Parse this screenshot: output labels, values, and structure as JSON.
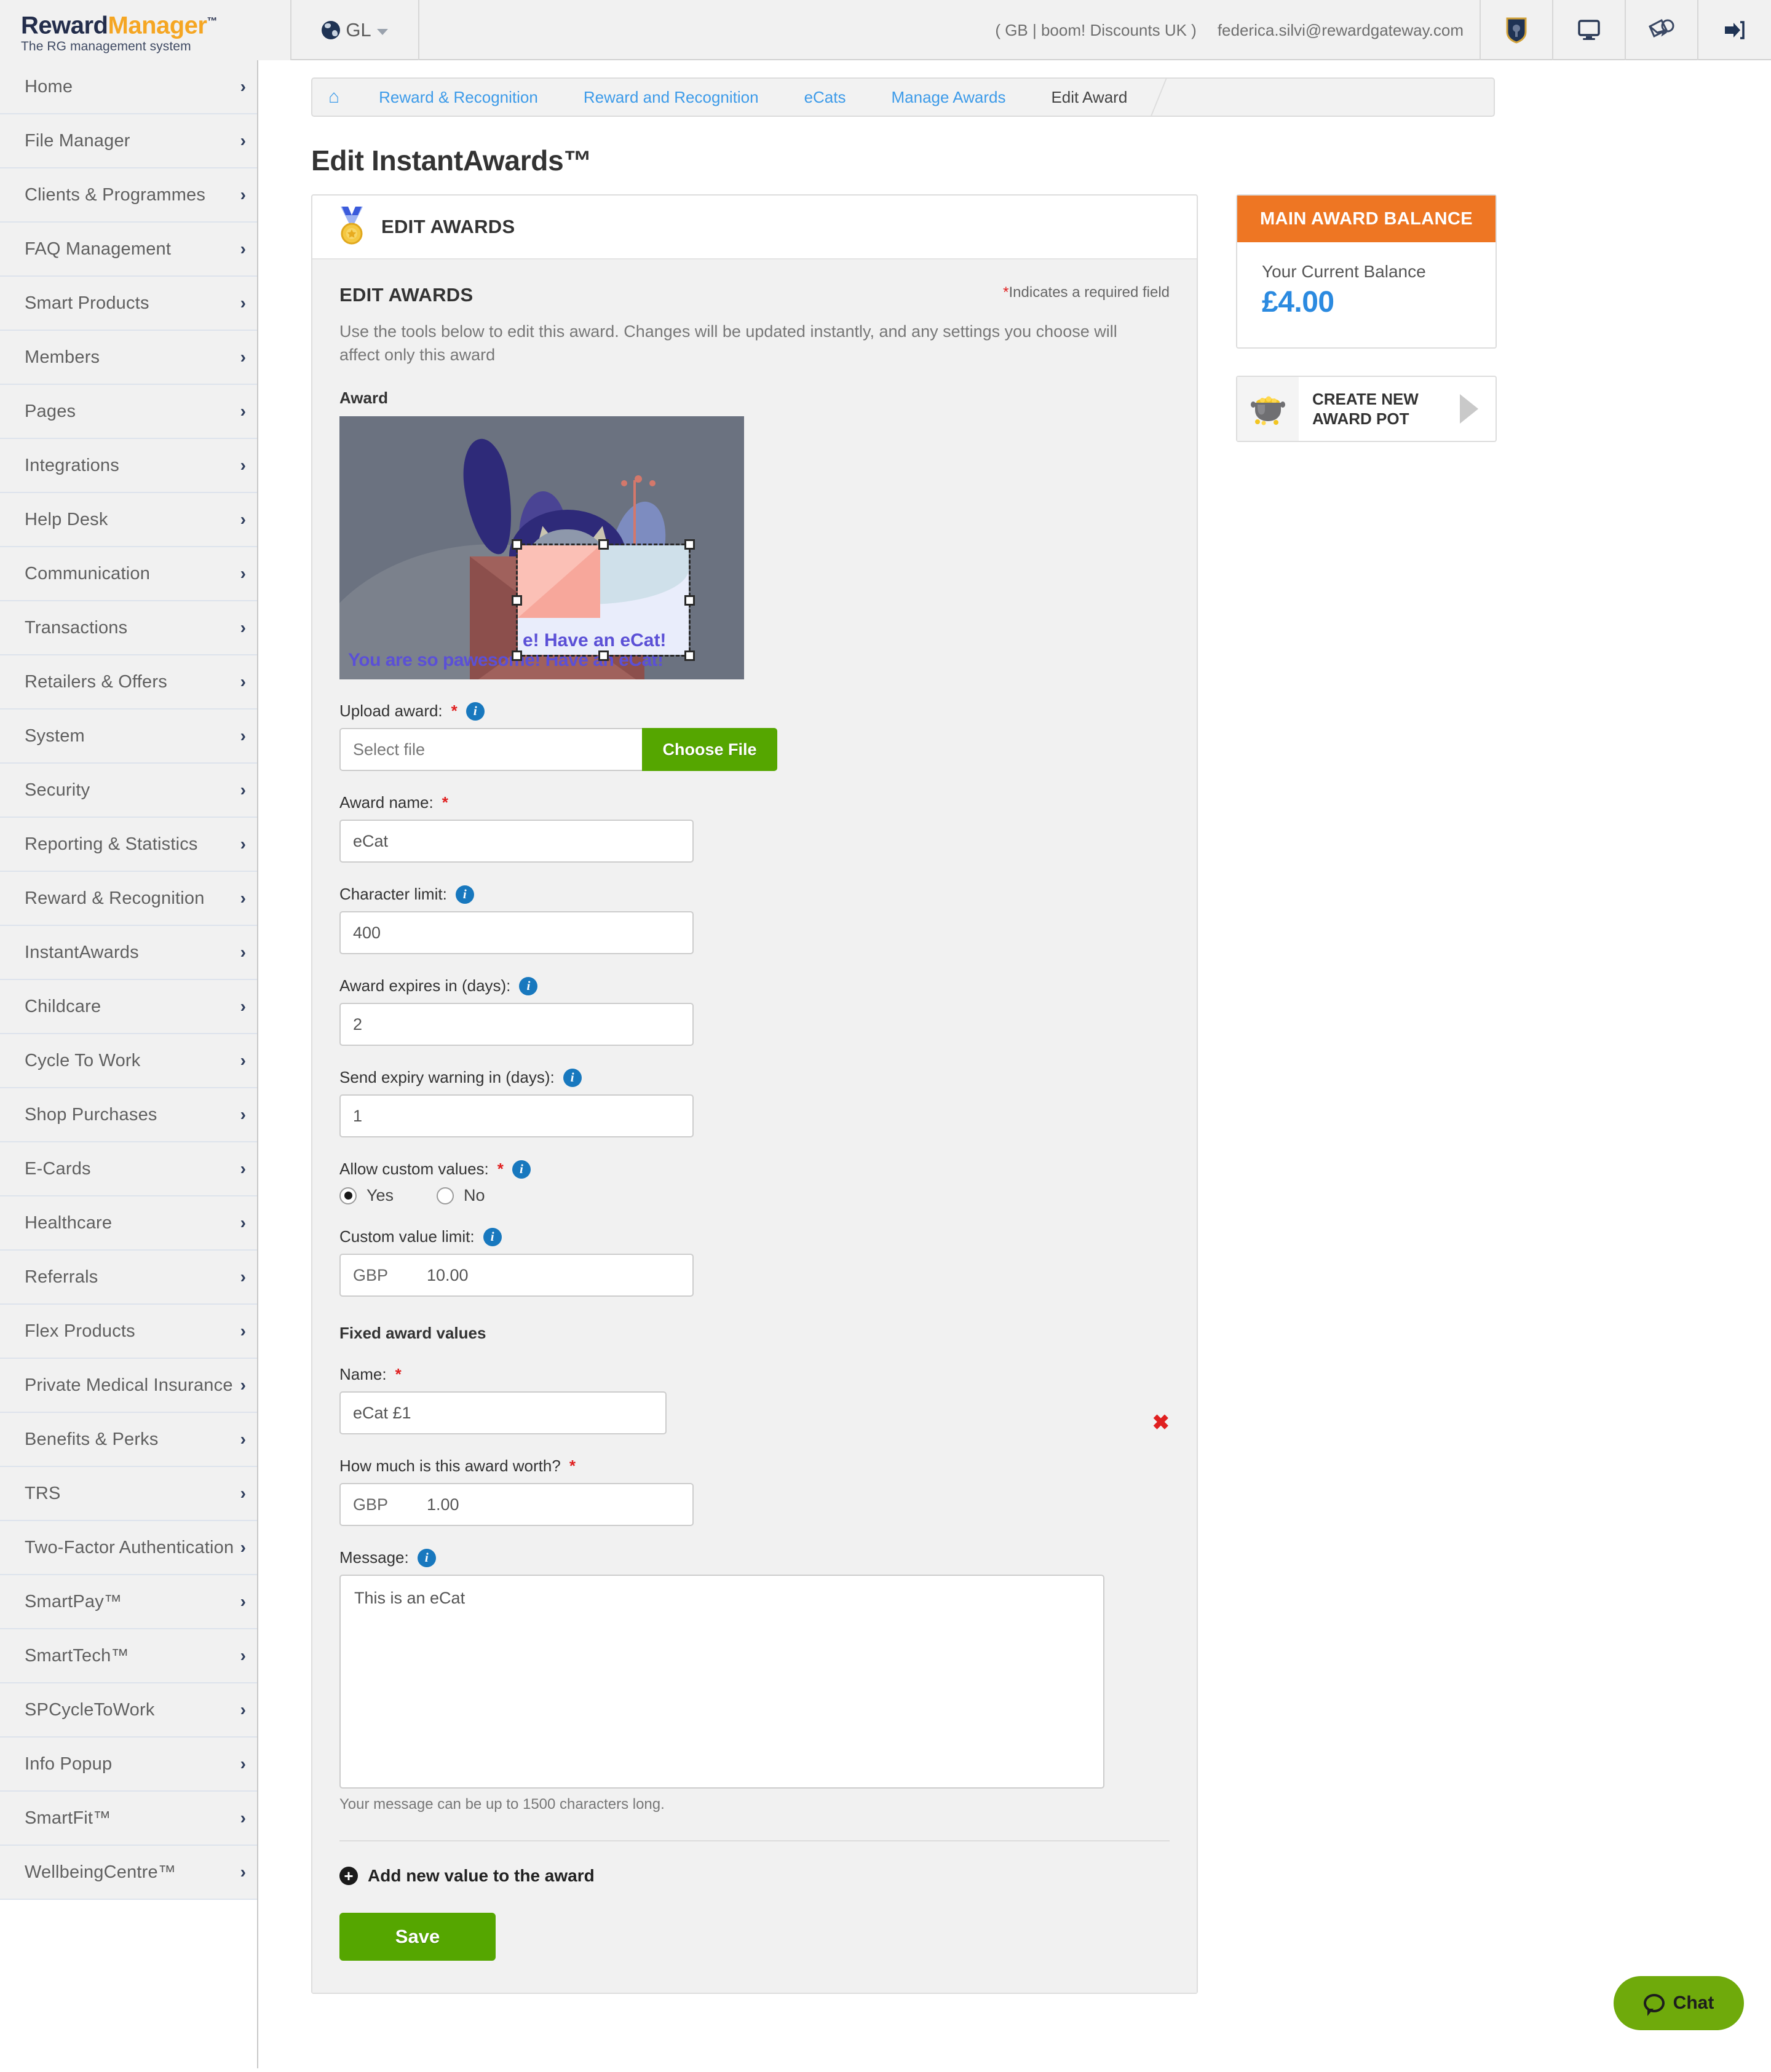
{
  "header": {
    "logo": {
      "part1": "Reward",
      "part2": "Manager",
      "tm": "™",
      "tagline": "The RG management system"
    },
    "locale_label": "GL",
    "account_org": "( GB | boom! Discounts UK )",
    "account_email": "federica.silvi@rewardgateway.com",
    "icons": [
      "badge-shield-icon",
      "monitor-icon",
      "envelope-message-icon",
      "logout-icon"
    ]
  },
  "sidebar": {
    "items": [
      {
        "label": "Home"
      },
      {
        "label": "File Manager"
      },
      {
        "label": "Clients & Programmes"
      },
      {
        "label": "FAQ Management"
      },
      {
        "label": "Smart Products"
      },
      {
        "label": "Members"
      },
      {
        "label": "Pages"
      },
      {
        "label": "Integrations"
      },
      {
        "label": "Help Desk"
      },
      {
        "label": "Communication"
      },
      {
        "label": "Transactions"
      },
      {
        "label": "Retailers & Offers"
      },
      {
        "label": "System"
      },
      {
        "label": "Security"
      },
      {
        "label": "Reporting & Statistics"
      },
      {
        "label": "Reward & Recognition"
      },
      {
        "label": "InstantAwards"
      },
      {
        "label": "Childcare"
      },
      {
        "label": "Cycle To Work"
      },
      {
        "label": "Shop Purchases"
      },
      {
        "label": "E-Cards"
      },
      {
        "label": "Healthcare"
      },
      {
        "label": "Referrals"
      },
      {
        "label": "Flex Products"
      },
      {
        "label": "Private Medical Insurance"
      },
      {
        "label": "Benefits & Perks"
      },
      {
        "label": "TRS"
      },
      {
        "label": "Two-Factor Authentication"
      },
      {
        "label": "SmartPay™"
      },
      {
        "label": "SmartTech™"
      },
      {
        "label": "SPCycleToWork"
      },
      {
        "label": "Info Popup"
      },
      {
        "label": "SmartFit™"
      },
      {
        "label": "WellbeingCentre™"
      }
    ],
    "arrow": "›"
  },
  "breadcrumb": {
    "home_icon": "⌂",
    "items": [
      {
        "label": "Reward & Recognition"
      },
      {
        "label": "Reward and Recognition"
      },
      {
        "label": "eCats"
      },
      {
        "label": "Manage Awards"
      },
      {
        "label": "Edit Award"
      }
    ]
  },
  "page": {
    "title": "Edit InstantAwards™"
  },
  "card": {
    "header_title": "EDIT AWARDS",
    "header_icon": "medal-icon",
    "section_title": "EDIT AWARDS",
    "required_note_star": "*",
    "required_note": "Indicates a required field",
    "lead": "Use the tools below to edit this award. Changes will be updated instantly, and any settings you choose will affect only this award",
    "award_label": "Award",
    "award_image": {
      "caption": "You are so pawesome! Have an eCat!",
      "overlay_caption": "e! Have an eCat!",
      "alt": "cat-in-envelope-illustration"
    },
    "fields": {
      "upload": {
        "label": "Upload award:",
        "star": "*",
        "placeholder": "Select file",
        "button": "Choose File"
      },
      "award_name": {
        "label": "Award name:",
        "star": "*",
        "value": "eCat"
      },
      "character_limit": {
        "label": "Character limit:",
        "value": "400"
      },
      "expires_days": {
        "label": "Award expires in (days):",
        "value": "2"
      },
      "expiry_warning_days": {
        "label": "Send expiry warning in (days):",
        "value": "1"
      },
      "allow_custom": {
        "label": "Allow custom values:",
        "star": "*",
        "options": [
          {
            "label": "Yes",
            "selected": true
          },
          {
            "label": "No",
            "selected": false
          }
        ]
      },
      "custom_value_limit": {
        "label": "Custom value limit:",
        "currency": "GBP",
        "value": "10.00"
      },
      "fixed_values_heading": "Fixed award values",
      "fixed_name": {
        "label": "Name:",
        "star": "*",
        "value": "eCat £1"
      },
      "fixed_worth": {
        "label": "How much is this award worth?",
        "star": "*",
        "currency": "GBP",
        "value": "1.00"
      },
      "message": {
        "label": "Message:",
        "value": "This is an eCat",
        "hint": "Your message can be up to 1500 characters long."
      },
      "remove_icon": "✖"
    },
    "add_new_value": "Add new value to the award",
    "add_icon": "+",
    "save_label": "Save"
  },
  "rail": {
    "balance": {
      "header": "MAIN AWARD BALANCE",
      "label": "Your Current Balance",
      "amount": "£4.00"
    },
    "pot": {
      "line1": "CREATE NEW",
      "line2": "AWARD POT",
      "icon": "pot-of-gold-icon"
    }
  },
  "chat": {
    "label": "Chat",
    "icon": "chat-bubble-icon"
  },
  "colors": {
    "accent_green": "#55a600",
    "orange": "#ee7623",
    "link_blue": "#3d9be9",
    "amount_blue": "#2b8ae0",
    "required_red": "#e02020",
    "brand_navy": "#232d4b",
    "brand_amber": "#f5a623"
  }
}
